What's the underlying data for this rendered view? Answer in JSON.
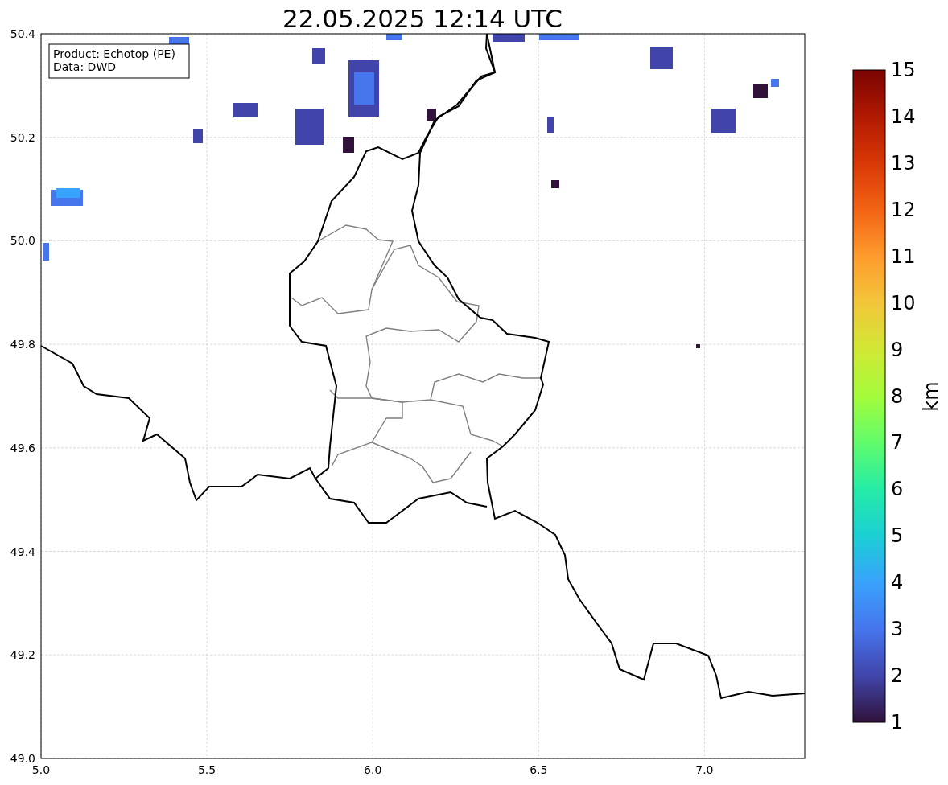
{
  "title": "22.05.2025 12:14 UTC",
  "info_box": {
    "lines": [
      "Product: Echotop (PE)",
      "Data: DWD"
    ]
  },
  "x_axis": {
    "ticks": [
      "5.0",
      "5.5",
      "6.0",
      "6.5",
      "7.0"
    ]
  },
  "y_axis": {
    "ticks": [
      "50.4",
      "50.2",
      "50.0",
      "49.8",
      "49.6",
      "49.4",
      "49.2",
      "49.0"
    ]
  },
  "colorbar": {
    "label": "km",
    "ticks": [
      "15",
      "14",
      "13",
      "12",
      "11",
      "10",
      "9",
      "8",
      "7",
      "6",
      "5",
      "4",
      "3",
      "2",
      "1"
    ]
  }
}
